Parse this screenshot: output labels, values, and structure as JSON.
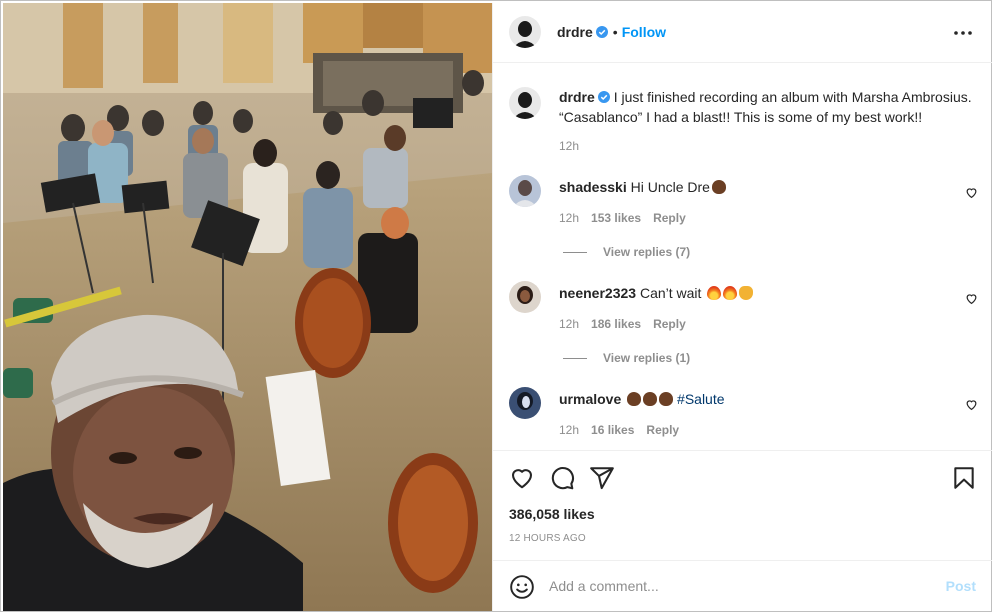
{
  "post": {
    "author": {
      "username": "drdre",
      "verified": true,
      "follow_label": "Follow",
      "dot": "•"
    },
    "caption": {
      "username": "drdre",
      "text": "I just finished recording an album with Marsha Ambrosius. “Casablanco” I had a blast!! This is some of my best work!!",
      "time": "12h"
    },
    "comments": [
      {
        "username": "shadesski",
        "text": "Hi Uncle Dre",
        "emojis": [
          "raising-hands-dark-emoji"
        ],
        "time": "12h",
        "likes": "153 likes",
        "reply_label": "Reply",
        "view_replies": "View replies (7)"
      },
      {
        "username": "neener2323",
        "text": "Can’t wait",
        "emojis": [
          "fire-emoji",
          "fire-emoji",
          "praise-hands-emoji"
        ],
        "time": "12h",
        "likes": "186 likes",
        "reply_label": "Reply",
        "view_replies": "View replies (1)"
      },
      {
        "username": "urmalove",
        "emojis": [
          "raising-hands-dark-emoji",
          "raising-hands-dark-emoji",
          "raising-hands-dark-emoji"
        ],
        "hashtag": "#Salute",
        "time": "12h",
        "likes": "16 likes",
        "reply_label": "Reply"
      }
    ],
    "likes_count": "386,058 likes",
    "posted_ago": "12 HOURS AGO",
    "add_comment": {
      "placeholder": "Add a comment...",
      "post_label": "Post"
    }
  },
  "icons": {
    "more": "more-options-icon",
    "like": "heart-icon",
    "comment": "comment-icon",
    "share": "share-icon",
    "save": "bookmark-icon",
    "emoji": "emoji-icon",
    "verified": "verified-badge-icon"
  },
  "colors": {
    "link_blue": "#0095f6",
    "post_disabled": "#b2dffc",
    "muted": "#8e8e8e",
    "text": "#262626",
    "hashtag": "#00376b"
  }
}
